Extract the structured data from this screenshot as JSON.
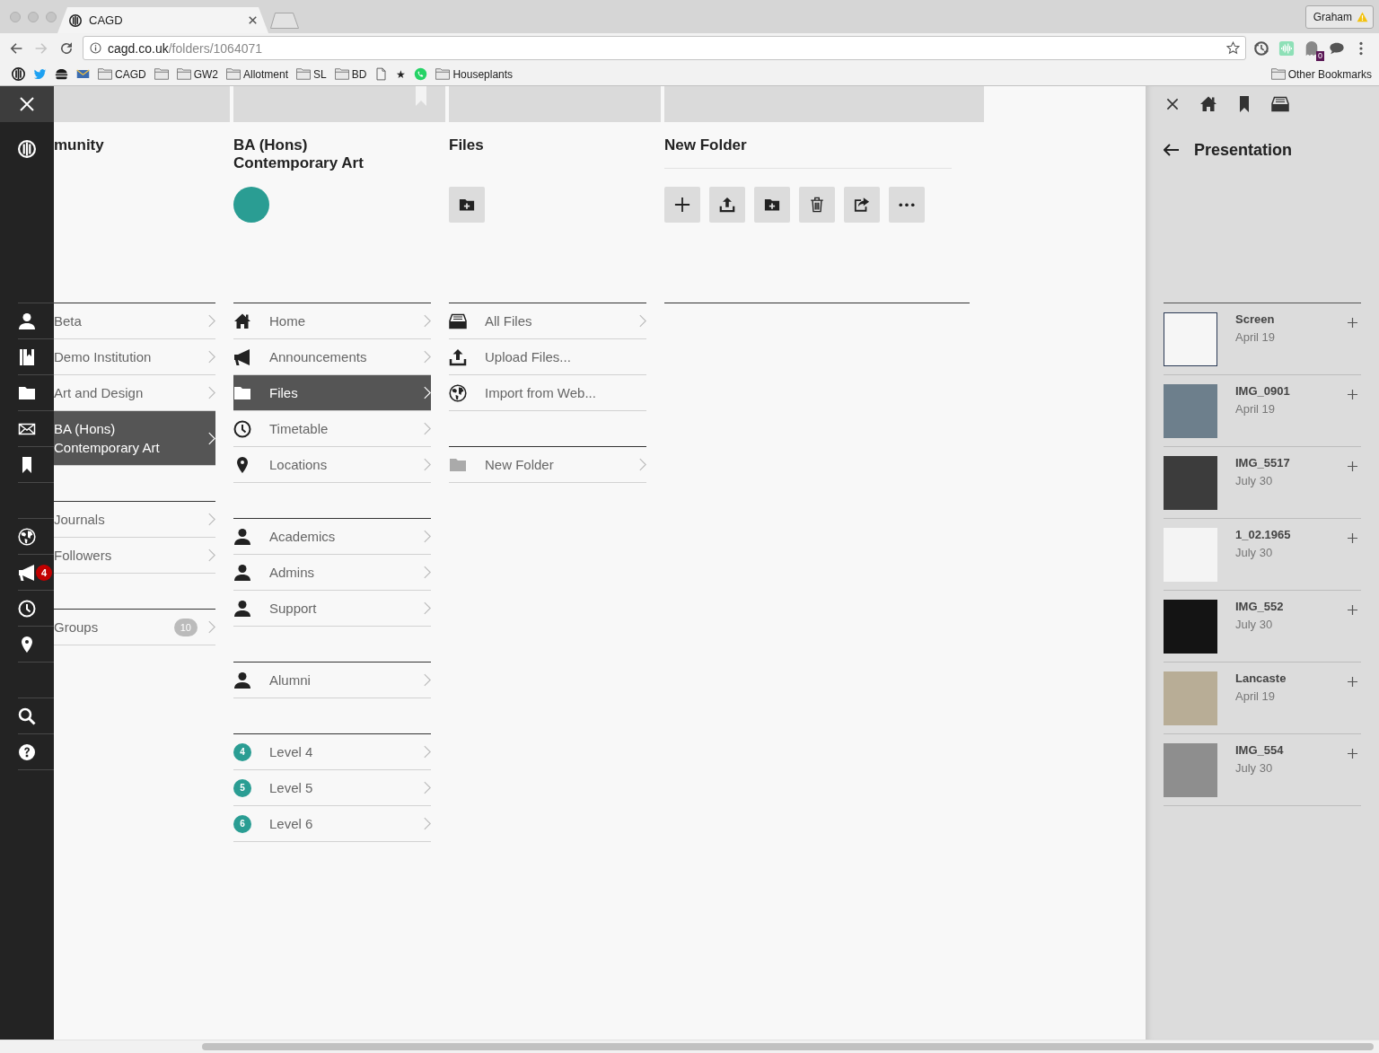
{
  "browser": {
    "tab": {
      "title": "CAGD"
    },
    "profile": {
      "name": "Graham",
      "warning": true
    },
    "nav": [
      {
        "kind": "back",
        "disabled": false
      },
      {
        "kind": "forward",
        "disabled": true
      },
      {
        "kind": "reload",
        "disabled": false
      }
    ],
    "address": {
      "host": "cagd.co.uk",
      "path": "/folders/1064071"
    },
    "extensions": [
      {
        "kind": "sync"
      },
      {
        "kind": "wave"
      },
      {
        "kind": "ghost",
        "badge": "0"
      },
      {
        "kind": "chat"
      }
    ],
    "bookmarks": [
      {
        "kind": "logo"
      },
      {
        "kind": "bird"
      },
      {
        "kind": "burger"
      },
      {
        "kind": "mail"
      },
      {
        "kind": "folder",
        "label": "CAGD"
      },
      {
        "kind": "folder"
      },
      {
        "kind": "folder",
        "label": "GW2"
      },
      {
        "kind": "folder",
        "label": "Allotment"
      },
      {
        "kind": "folder",
        "label": "SL"
      },
      {
        "kind": "folder",
        "label": "BD"
      },
      {
        "kind": "page"
      },
      {
        "kind": "text",
        "label": "★"
      },
      {
        "kind": "phone"
      },
      {
        "kind": "folder",
        "label": "Houseplants"
      }
    ],
    "other_bookmarks": {
      "label": "Other Bookmarks"
    }
  },
  "sidebar": {
    "groups": [
      {
        "items": [
          {
            "kind": "user"
          },
          {
            "kind": "book"
          },
          {
            "kind": "folder"
          },
          {
            "kind": "mail"
          },
          {
            "kind": "bookmark"
          }
        ]
      },
      {
        "items": [
          {
            "kind": "globe"
          },
          {
            "kind": "megaphone",
            "badge": "4"
          },
          {
            "kind": "clock"
          },
          {
            "kind": "pin"
          }
        ]
      },
      {
        "items": [
          {
            "kind": "search"
          },
          {
            "kind": "help"
          }
        ]
      }
    ]
  },
  "columns": [
    {
      "title": "munity",
      "bookmark": false,
      "groups": [
        {
          "items": [
            {
              "label": "Beta",
              "selected": false,
              "chevron": true
            },
            {
              "label": "Demo Institution",
              "selected": false,
              "chevron": true
            },
            {
              "label": "Art and Design",
              "selected": false,
              "chevron": true
            },
            {
              "label": "BA (Hons)\nContemporary Art",
              "selected": true,
              "chevron": true
            }
          ]
        },
        {
          "items": [
            {
              "label": "Journals",
              "selected": false,
              "chevron": true
            },
            {
              "label": "Followers",
              "selected": false,
              "chevron": true
            }
          ]
        },
        {
          "items": [
            {
              "label": "Groups",
              "badge": "10",
              "selected": false,
              "chevron": true
            }
          ]
        }
      ]
    },
    {
      "title": "BA (Hons)\nContemporary Art",
      "bookmark": true,
      "avatar": true,
      "groups": [
        {
          "items": [
            {
              "kind": "home",
              "label": "Home",
              "selected": false,
              "chevron": true
            },
            {
              "kind": "megaphone",
              "label": "Announcements",
              "selected": false,
              "chevron": true
            },
            {
              "kind": "folder",
              "label": "Files",
              "selected": true,
              "chevron": true
            },
            {
              "kind": "clock",
              "label": "Timetable",
              "selected": false,
              "chevron": true
            },
            {
              "kind": "pin",
              "label": "Locations",
              "selected": false,
              "chevron": true
            }
          ]
        },
        {
          "items": [
            {
              "kind": "person",
              "label": "Academics",
              "selected": false,
              "chevron": true
            },
            {
              "kind": "person",
              "label": "Admins",
              "selected": false,
              "chevron": true
            },
            {
              "kind": "person",
              "label": "Support",
              "selected": false,
              "chevron": true
            }
          ]
        },
        {
          "items": [
            {
              "kind": "person",
              "label": "Alumni",
              "selected": false,
              "chevron": true
            }
          ]
        },
        {
          "items": [
            {
              "kind": "number",
              "number": "4",
              "label": "Level 4",
              "selected": false,
              "chevron": true
            },
            {
              "kind": "number",
              "number": "5",
              "label": "Level 5",
              "selected": false,
              "chevron": true
            },
            {
              "kind": "number",
              "number": "6",
              "label": "Level 6",
              "selected": false,
              "chevron": true
            }
          ]
        }
      ]
    },
    {
      "title": "Files",
      "bookmark": false,
      "actions": [
        {
          "kind": "new-folder"
        }
      ],
      "groups": [
        {
          "items": [
            {
              "kind": "tray",
              "label": "All Files",
              "selected": false,
              "chevron": true
            },
            {
              "kind": "upload",
              "label": "Upload Files...",
              "selected": false,
              "chevron": false
            },
            {
              "kind": "globe",
              "label": "Import from Web...",
              "selected": false,
              "chevron": false
            }
          ]
        },
        {
          "items": [
            {
              "kind": "subfolder",
              "label": "New Folder",
              "selected": false,
              "chevron": true
            }
          ]
        }
      ]
    },
    {
      "title_field": {
        "value": "New Folder"
      },
      "bookmark": false,
      "actions": [
        {
          "kind": "add"
        },
        {
          "kind": "upload"
        },
        {
          "kind": "new-folder"
        },
        {
          "kind": "delete"
        },
        {
          "kind": "share"
        },
        {
          "kind": "more"
        }
      ]
    }
  ],
  "panel": {
    "tools": [
      {
        "kind": "close"
      },
      {
        "kind": "home"
      },
      {
        "kind": "bookmark"
      },
      {
        "kind": "tray"
      }
    ],
    "title": "Presentation",
    "items": [
      {
        "name": "Screen",
        "date": "April 19"
      },
      {
        "name": "IMG_0901",
        "date": "April 19"
      },
      {
        "name": "IMG_5517",
        "date": "July 30"
      },
      {
        "name": "1_02.1965",
        "date": "July 30"
      },
      {
        "name": "IMG_552",
        "date": "July 30"
      },
      {
        "name": "Lancaste",
        "date": "April 19"
      },
      {
        "name": "IMG_554",
        "date": "July 30"
      }
    ]
  }
}
